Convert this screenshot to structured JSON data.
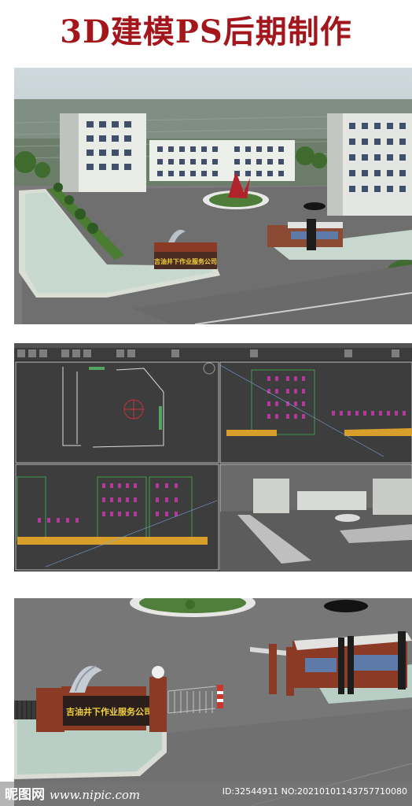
{
  "header": {
    "title": "3D建模PS后期制作"
  },
  "sign": {
    "company_name": "吉油井下作业服务公司"
  },
  "watermark": {
    "logo_text": "昵图网",
    "site": "www.nipic.com",
    "id_text": "ID:32544911 NO:20210101143757710080"
  }
}
